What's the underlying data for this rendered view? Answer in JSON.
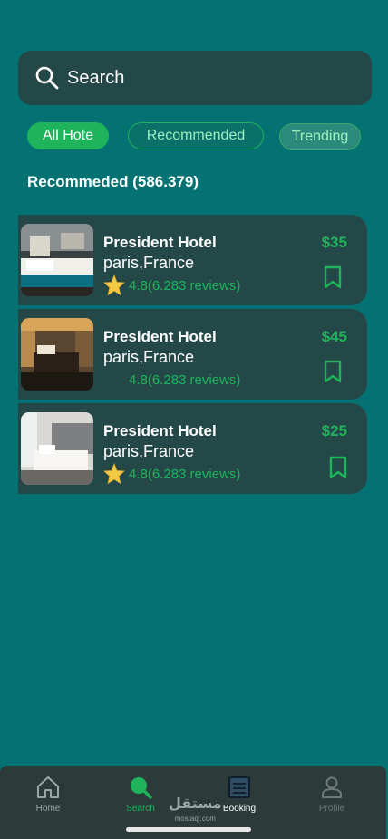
{
  "search": {
    "placeholder": "Search"
  },
  "filters": [
    {
      "label": "All Hote",
      "active": true
    },
    {
      "label": "Recommended",
      "active": false
    },
    {
      "label": "Trending",
      "active": false
    }
  ],
  "section": {
    "title": "Recommeded (586.379)"
  },
  "hotels": [
    {
      "name": "President Hotel",
      "location": "paris,France",
      "rating": "4.8(6.283 reviews)",
      "price": "$35",
      "star_icon": true
    },
    {
      "name": "President Hotel",
      "location": "paris,France",
      "rating": "4.8(6.283 reviews)",
      "price": "$45",
      "star_icon": false
    },
    {
      "name": "President Hotel",
      "location": "paris,France",
      "rating": "4.8(6.283 reviews)",
      "price": "$25",
      "star_icon": true
    }
  ],
  "nav": [
    {
      "label": "Home",
      "icon": "home-icon"
    },
    {
      "label": "Search",
      "icon": "search-icon",
      "active": true
    },
    {
      "label": "Booking",
      "icon": "booking-icon"
    },
    {
      "label": "Profile",
      "icon": "profile-icon"
    }
  ],
  "watermark": {
    "main": "مستقل",
    "sub": "mostaql.com"
  },
  "colors": {
    "background": "#047272",
    "card": "#244848",
    "accent": "#1fb45b",
    "navbar": "#2c3a3a"
  }
}
